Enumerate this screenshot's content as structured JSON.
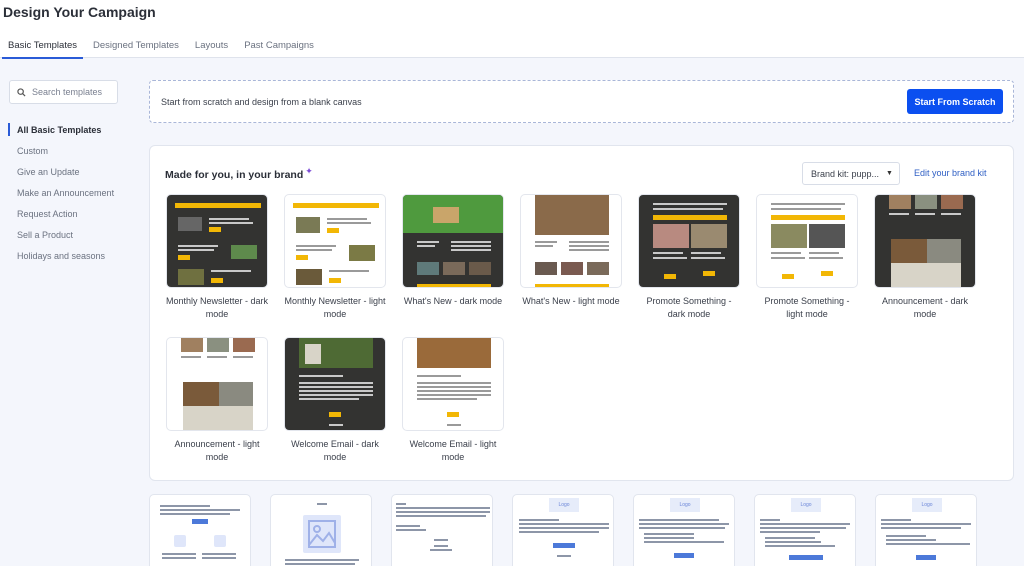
{
  "header": {
    "title": "Design Your Campaign"
  },
  "tabs": [
    {
      "label": "Basic Templates",
      "active": true
    },
    {
      "label": "Designed Templates",
      "active": false
    },
    {
      "label": "Layouts",
      "active": false
    },
    {
      "label": "Past Campaigns",
      "active": false
    }
  ],
  "sidebar": {
    "search": {
      "placeholder": "Search templates",
      "value": "",
      "icon": "search-icon"
    },
    "items": [
      {
        "label": "All Basic Templates",
        "active": true
      },
      {
        "label": "Custom"
      },
      {
        "label": "Give an Update"
      },
      {
        "label": "Make an Announcement"
      },
      {
        "label": "Request Action"
      },
      {
        "label": "Sell a Product"
      },
      {
        "label": "Holidays and seasons"
      }
    ]
  },
  "scratch": {
    "text": "Start from scratch and design from a blank canvas",
    "button_label": "Start From Scratch"
  },
  "brand": {
    "title": "Made for you, in your brand",
    "sparkle_icon": "sparkle-icon",
    "select_value": "Brand kit: pupp...",
    "edit_link": "Edit your brand kit"
  },
  "templates": [
    {
      "label": "Monthly Newsletter - dark mode",
      "theme": "dark"
    },
    {
      "label": "Monthly Newsletter - light mode",
      "theme": "light"
    },
    {
      "label": "What's New - dark mode",
      "theme": "dark"
    },
    {
      "label": "What's New - light mode",
      "theme": "light"
    },
    {
      "label": "Promote Something - dark mode",
      "theme": "dark"
    },
    {
      "label": "Promote Something - light mode",
      "theme": "light"
    },
    {
      "label": "Announcement - dark mode",
      "theme": "dark"
    },
    {
      "label": "Announcement - light mode",
      "theme": "light"
    },
    {
      "label": "Welcome Email - dark mode",
      "theme": "dark"
    },
    {
      "label": "Welcome Email - light mode",
      "theme": "light"
    }
  ],
  "layouts": [
    {
      "logo": ""
    },
    {
      "logo": ""
    },
    {
      "logo": ""
    },
    {
      "logo": "Logo"
    },
    {
      "logo": "Logo"
    },
    {
      "logo": "Logo"
    },
    {
      "logo": "Logo"
    }
  ],
  "colors": {
    "accent": "#0b4ff0",
    "tab_underline": "#2a5bd7",
    "link": "#2f5fc4",
    "template_yellow": "#f2b705",
    "dark_template_bg": "#333331",
    "sparkle": "#7b4bd6"
  }
}
